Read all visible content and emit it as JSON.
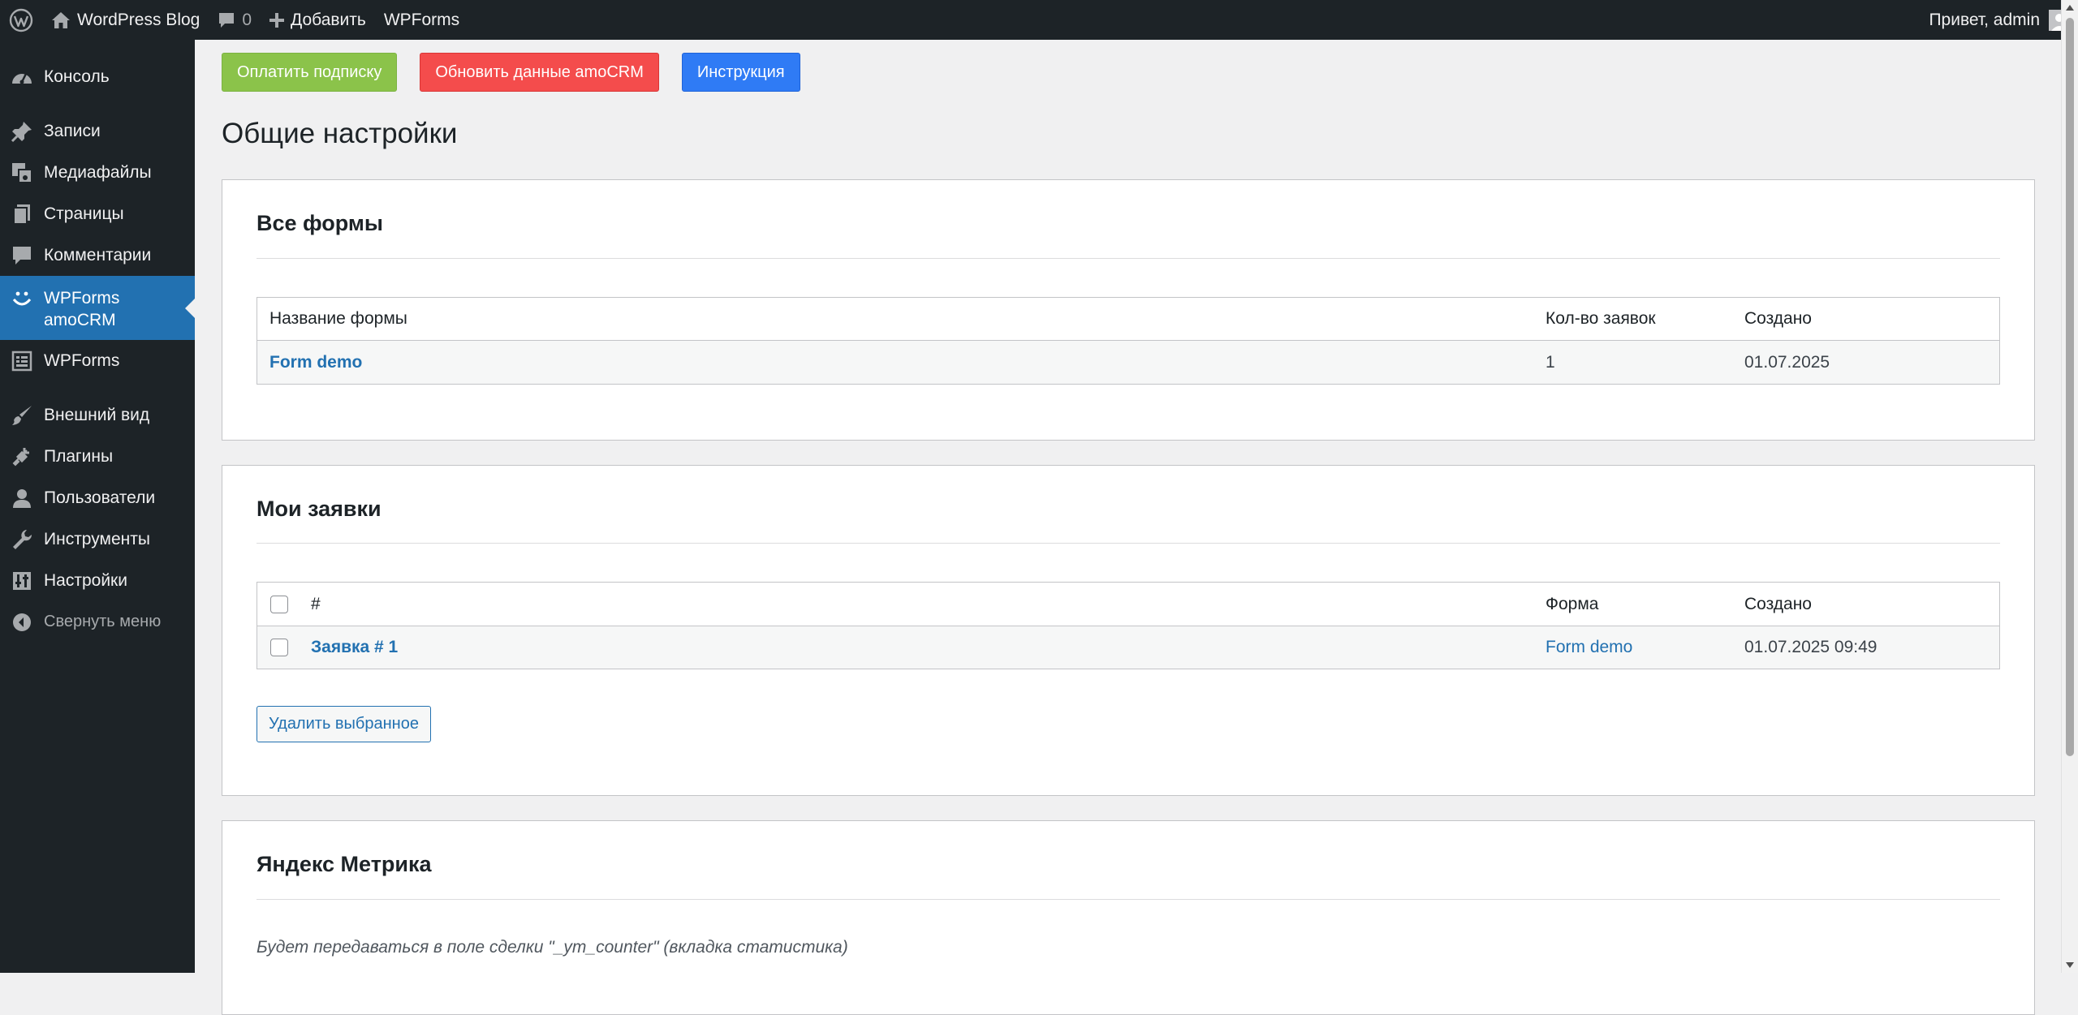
{
  "adminbar": {
    "site_name": "WordPress Blog",
    "comments_count": "0",
    "add_label": "Добавить",
    "wpforms_label": "WPForms",
    "greeting": "Привет, admin"
  },
  "menu": {
    "items": [
      {
        "label": "Консоль",
        "icon": "dashboard-icon"
      },
      {
        "label": "Записи",
        "icon": "pushpin-icon"
      },
      {
        "label": "Медиафайлы",
        "icon": "media-icon"
      },
      {
        "label": "Страницы",
        "icon": "pages-icon"
      },
      {
        "label": "Комментарии",
        "icon": "comment-icon"
      },
      {
        "label": "WPForms amoCRM",
        "icon": "smiley-icon"
      },
      {
        "label": "WPForms",
        "icon": "form-icon"
      },
      {
        "label": "Внешний вид",
        "icon": "brush-icon"
      },
      {
        "label": "Плагины",
        "icon": "plugin-icon"
      },
      {
        "label": "Пользователи",
        "icon": "user-icon"
      },
      {
        "label": "Инструменты",
        "icon": "wrench-icon"
      },
      {
        "label": "Настройки",
        "icon": "settings-icon"
      }
    ],
    "collapse_label": "Свернуть меню"
  },
  "buttons": {
    "pay": "Оплатить подписку",
    "refresh": "Обновить данные amoCRM",
    "instructions": "Инструкция"
  },
  "colors": {
    "pay": "#8bc34a",
    "refresh": "#f44c4c",
    "instructions": "#2f7bf5",
    "accent": "#2271b1"
  },
  "page_title": "Общие настройки",
  "forms_card": {
    "title": "Все формы",
    "columns": [
      "Название формы",
      "Кол-во заявок",
      "Создано"
    ],
    "rows": [
      {
        "name": "Form demo",
        "count": "1",
        "created": "01.07.2025"
      }
    ]
  },
  "requests_card": {
    "title": "Мои заявки",
    "columns": [
      "#",
      "Форма",
      "Создано"
    ],
    "rows": [
      {
        "title": "Заявка # 1",
        "form": "Form demo",
        "created": "01.07.2025 09:49"
      }
    ],
    "delete_label": "Удалить выбранное"
  },
  "metrika_card": {
    "title": "Яндекс Метрика",
    "note": "Будет передаваться в поле сделки \"_ym_counter\" (вкладка статистика)"
  }
}
